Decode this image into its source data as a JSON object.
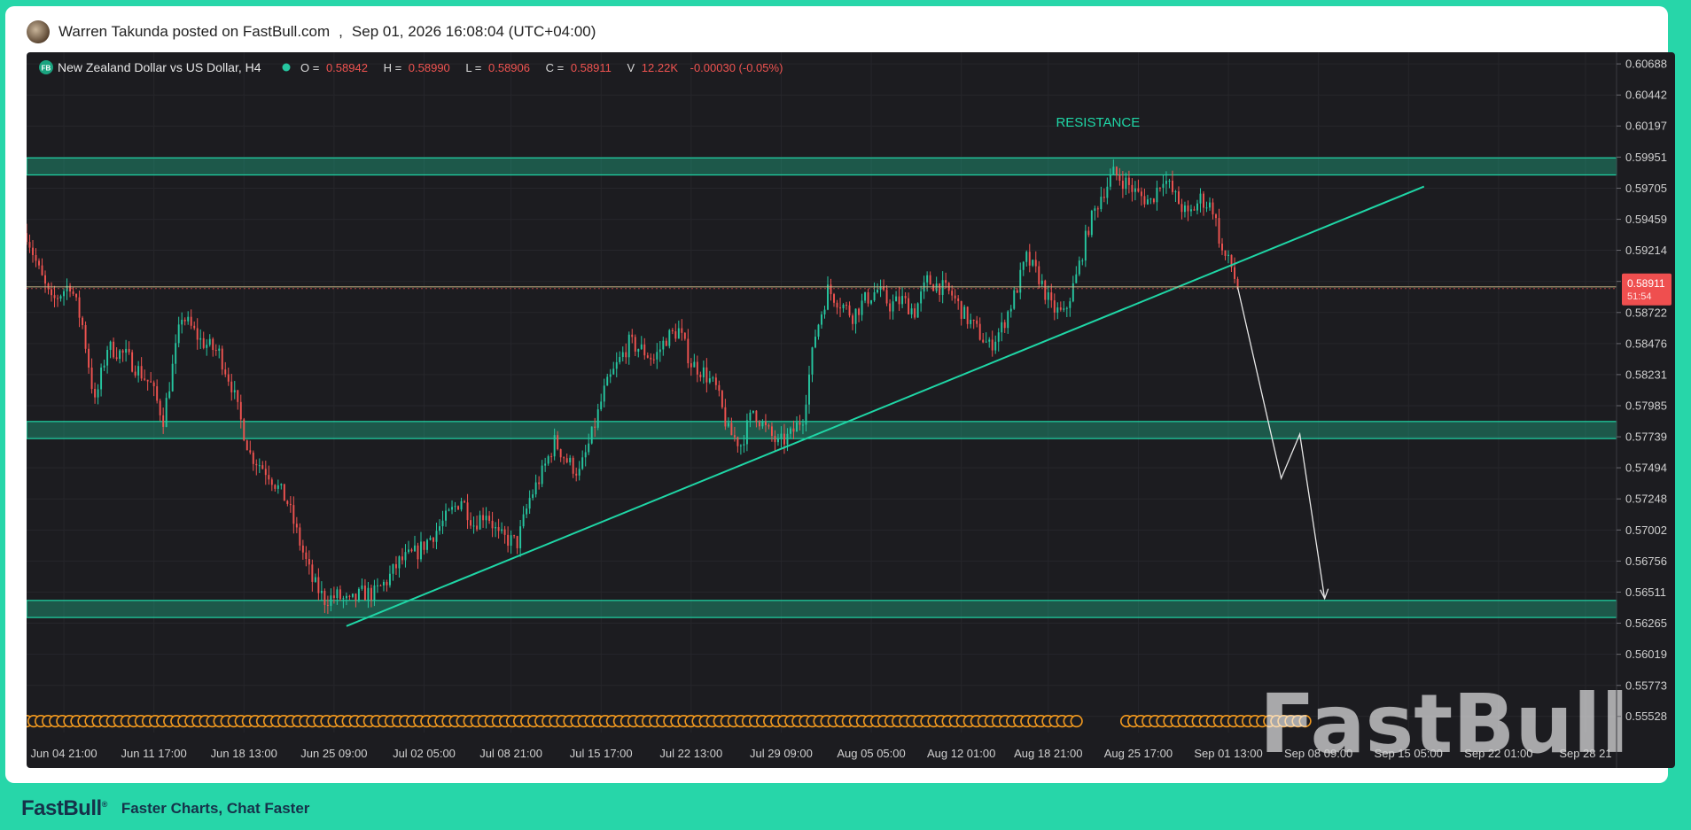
{
  "post": {
    "author_line": "Warren Takunda posted on FastBull.com",
    "separator": ",",
    "timestamp": "Sep 01, 2026 16:08:04 (UTC+04:00)"
  },
  "footer": {
    "brand": "FastBull",
    "brand_mark": "®",
    "tagline": "Faster Charts, Chat Faster"
  },
  "watermark": "FastBull",
  "colors": {
    "up": "#26c6a0",
    "down": "#ef5350",
    "zone": "#1fd6a6",
    "price_tag": "#ef4f4f"
  },
  "chart_data": {
    "type": "candlestick",
    "symbol_badge": "FB",
    "symbol": "New Zealand Dollar vs US Dollar, H4",
    "ohlc": {
      "open_label": "O =",
      "open": "0.58942",
      "high_label": "H =",
      "high": "0.58990",
      "low_label": "L =",
      "low": "0.58906",
      "close_label": "C =",
      "close": "0.58911",
      "volume_label": "V",
      "volume": "12.22K",
      "change": "-0.00030 (-0.05%)"
    },
    "current_price": 0.58911,
    "current_price_label": "0.58911",
    "countdown": "51:54",
    "ylim": [
      0.554,
      0.6078
    ],
    "y_ticks": [
      0.60688,
      0.60442,
      0.60197,
      0.59951,
      0.59705,
      0.59459,
      0.59214,
      0.58968,
      0.58722,
      0.58476,
      0.58231,
      0.57985,
      0.57739,
      0.57494,
      0.57248,
      0.57002,
      0.56756,
      0.56511,
      0.56265,
      0.56019,
      0.55773,
      0.55528
    ],
    "y_tick_labels": [
      "0.60688",
      "0.60442",
      "0.60197",
      "0.59951",
      "0.59705",
      "0.59459",
      "0.59214",
      "",
      "0.58722",
      "0.58476",
      "0.58231",
      "0.57985",
      "0.57739",
      "0.57494",
      "0.57248",
      "0.57002",
      "0.56756",
      "0.56511",
      "0.56265",
      "0.56019",
      "0.55773",
      "0.55528"
    ],
    "x_range": [
      0,
      512
    ],
    "x_ticks": [
      {
        "label": "Jun 04 21:00",
        "x": 12
      },
      {
        "label": "Jun 11 17:00",
        "x": 41
      },
      {
        "label": "Jun 18 13:00",
        "x": 70
      },
      {
        "label": "Jun 25 09:00",
        "x": 99
      },
      {
        "label": "Jul 02 05:00",
        "x": 128
      },
      {
        "label": "Jul 08 21:00",
        "x": 156
      },
      {
        "label": "Jul 15 17:00",
        "x": 185
      },
      {
        "label": "Jul 22 13:00",
        "x": 214
      },
      {
        "label": "Jul 29 09:00",
        "x": 243
      },
      {
        "label": "Aug 05 05:00",
        "x": 272
      },
      {
        "label": "Aug 12 01:00",
        "x": 301
      },
      {
        "label": "Aug 18 21:00",
        "x": 329
      },
      {
        "label": "Aug 25 17:00",
        "x": 358
      },
      {
        "label": "Sep 01 13:00",
        "x": 387
      },
      {
        "label": "Sep 08 09:00",
        "x": 416
      },
      {
        "label": "Sep 15 05:00",
        "x": 445
      },
      {
        "label": "Sep 22 01:00",
        "x": 474
      },
      {
        "label": "Sep 28 21",
        "x": 502
      }
    ],
    "last_candle_index": 390,
    "path_points": [
      [
        0,
        0.5935
      ],
      [
        4,
        0.5905
      ],
      [
        8,
        0.588
      ],
      [
        14,
        0.5895
      ],
      [
        18,
        0.5862
      ],
      [
        22,
        0.58
      ],
      [
        26,
        0.5845
      ],
      [
        32,
        0.5838
      ],
      [
        40,
        0.5815
      ],
      [
        44,
        0.5788
      ],
      [
        50,
        0.587
      ],
      [
        56,
        0.585
      ],
      [
        62,
        0.584
      ],
      [
        66,
        0.5815
      ],
      [
        68,
        0.5795
      ],
      [
        72,
        0.576
      ],
      [
        78,
        0.5745
      ],
      [
        84,
        0.5722
      ],
      [
        88,
        0.569
      ],
      [
        92,
        0.566
      ],
      [
        96,
        0.5645
      ],
      [
        100,
        0.5648
      ],
      [
        104,
        0.5642
      ],
      [
        108,
        0.565
      ],
      [
        112,
        0.565
      ],
      [
        116,
        0.566
      ],
      [
        120,
        0.5675
      ],
      [
        126,
        0.5683
      ],
      [
        132,
        0.57
      ],
      [
        136,
        0.5712
      ],
      [
        140,
        0.5725
      ],
      [
        144,
        0.5705
      ],
      [
        148,
        0.5715
      ],
      [
        152,
        0.5695
      ],
      [
        158,
        0.569
      ],
      [
        162,
        0.5725
      ],
      [
        166,
        0.5745
      ],
      [
        170,
        0.577
      ],
      [
        174,
        0.5755
      ],
      [
        178,
        0.5745
      ],
      [
        182,
        0.5775
      ],
      [
        186,
        0.581
      ],
      [
        190,
        0.583
      ],
      [
        194,
        0.5848
      ],
      [
        198,
        0.5843
      ],
      [
        202,
        0.5835
      ],
      [
        206,
        0.5852
      ],
      [
        210,
        0.5858
      ],
      [
        214,
        0.5832
      ],
      [
        218,
        0.5825
      ],
      [
        222,
        0.5812
      ],
      [
        226,
        0.5778
      ],
      [
        230,
        0.5768
      ],
      [
        234,
        0.5795
      ],
      [
        238,
        0.578
      ],
      [
        242,
        0.5768
      ],
      [
        246,
        0.5775
      ],
      [
        250,
        0.579
      ],
      [
        254,
        0.5855
      ],
      [
        258,
        0.589
      ],
      [
        262,
        0.588
      ],
      [
        266,
        0.587
      ],
      [
        270,
        0.5882
      ],
      [
        274,
        0.589
      ],
      [
        278,
        0.5878
      ],
      [
        282,
        0.5882
      ],
      [
        286,
        0.5873
      ],
      [
        290,
        0.5897
      ],
      [
        294,
        0.5893
      ],
      [
        298,
        0.5886
      ],
      [
        302,
        0.587
      ],
      [
        306,
        0.5858
      ],
      [
        310,
        0.5845
      ],
      [
        314,
        0.586
      ],
      [
        318,
        0.5885
      ],
      [
        322,
        0.5915
      ],
      [
        326,
        0.59
      ],
      [
        330,
        0.5876
      ],
      [
        334,
        0.587
      ],
      [
        338,
        0.59
      ],
      [
        342,
        0.594
      ],
      [
        346,
        0.5965
      ],
      [
        350,
        0.5982
      ],
      [
        354,
        0.5975
      ],
      [
        358,
        0.5965
      ],
      [
        362,
        0.596
      ],
      [
        366,
        0.598
      ],
      [
        370,
        0.5963
      ],
      [
        374,
        0.5948
      ],
      [
        378,
        0.5962
      ],
      [
        382,
        0.5955
      ],
      [
        385,
        0.592
      ],
      [
        388,
        0.5908
      ],
      [
        390,
        0.5891
      ]
    ],
    "zones": [
      {
        "name": "resistance-zone",
        "y1": 0.59945,
        "y2": 0.5981
      },
      {
        "name": "mid-support-zone",
        "y1": 0.5786,
        "y2": 0.57725
      },
      {
        "name": "lower-support-zone",
        "y1": 0.56445,
        "y2": 0.5631
      }
    ],
    "resistance_label": "RESISTANCE",
    "resistance_label_pos": {
      "x": 345,
      "y": 0.6019
    },
    "trendline": [
      [
        103,
        0.56242
      ],
      [
        450,
        0.59718
      ]
    ],
    "horizontal_line": 0.58925,
    "projection": [
      [
        390,
        0.5892
      ],
      [
        404,
        0.5741
      ],
      [
        410,
        0.5776
      ],
      [
        418,
        0.5646
      ]
    ],
    "event_markers_y": 0.5549
  }
}
